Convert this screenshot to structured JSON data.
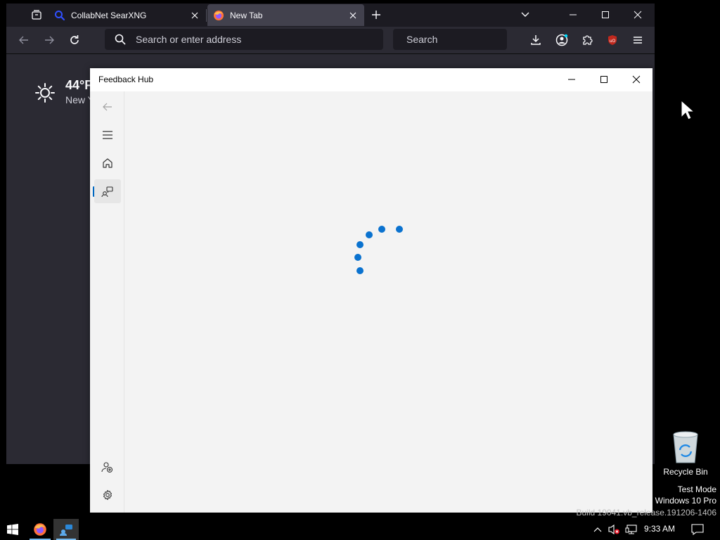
{
  "browser": {
    "tabs": [
      {
        "title": "CollabNet SearXNG",
        "favicon": "search-favicon",
        "active": false
      },
      {
        "title": "New Tab",
        "favicon": "firefox-favicon",
        "active": true
      }
    ],
    "urlbar_placeholder": "Search or enter address",
    "searchbar_placeholder": "Search",
    "weather": {
      "temp": "44°F",
      "location": "New Y"
    },
    "colors": {
      "tabstrip": "#1c1b22",
      "toolbar": "#2b2a33",
      "field": "#1c1b22",
      "ublock": "#c0281d"
    }
  },
  "feedback_hub": {
    "title": "Feedback Hub",
    "nav_icons": [
      "back-arrow-icon",
      "hamburger-icon",
      "home-icon",
      "feedback-icon",
      "add-person-icon",
      "settings-icon"
    ],
    "loading": true,
    "colors": {
      "accent": "#0a72cf",
      "background": "#f3f3f3"
    }
  },
  "desktop": {
    "recycle_bin_label": "Recycle Bin",
    "watermark": {
      "line1": "Test Mode",
      "line2": "Windows 10 Pro",
      "line3": "Build 19041.vb_release.191206-1406"
    }
  },
  "taskbar": {
    "time": "9:33 AM",
    "apps": [
      "start-button",
      "firefox",
      "feedback-hub"
    ]
  }
}
